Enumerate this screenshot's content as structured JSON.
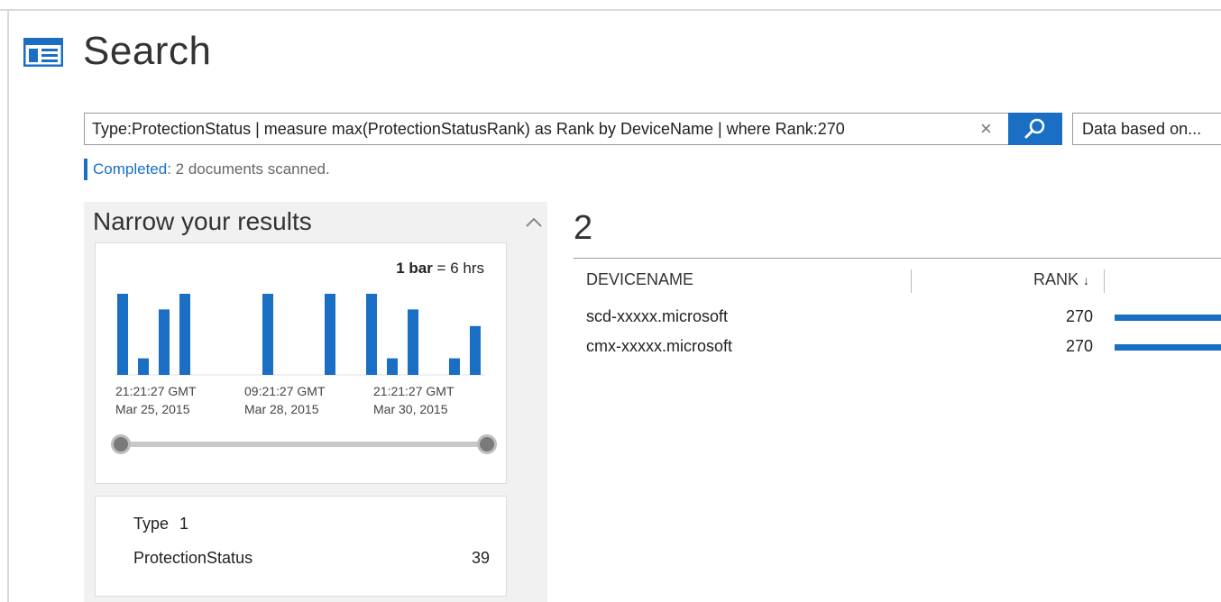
{
  "page": {
    "title": "Search"
  },
  "search": {
    "query": "Type:ProtectionStatus | measure max(ProtectionStatusRank) as Rank by DeviceName | where Rank:270",
    "clear_symbol": "×",
    "data_based_label": "Data based on..."
  },
  "status": {
    "completed": "Completed",
    "detail": " : 2 documents scanned."
  },
  "narrow": {
    "title": "Narrow your results",
    "legend_bold": "1 bar",
    "legend_rest": " = 6 hrs",
    "type_label": "Type",
    "type_count": "1",
    "type_value": "ProtectionStatus",
    "type_value_count": "39",
    "slider": {
      "start": 0,
      "end": 1
    }
  },
  "chart_data": {
    "type": "bar",
    "values": [
      88,
      18,
      71,
      88,
      0,
      0,
      0,
      88,
      0,
      0,
      88,
      0,
      88,
      18,
      71,
      0,
      18,
      53
    ],
    "tick_labels": [
      {
        "time": "21:21:27 GMT",
        "date": "Mar 25, 2015"
      },
      {
        "time": "09:21:27 GMT",
        "date": "Mar 28, 2015"
      },
      {
        "time": "21:21:27 GMT",
        "date": "Mar 30, 2015"
      }
    ],
    "color": "#1a6fc4"
  },
  "results": {
    "count": "2",
    "columns": {
      "device": "DEVICENAME",
      "rank": "RANK"
    },
    "sort_indicator": "↓",
    "rows": [
      {
        "device": "scd-xxxxx.microsoft",
        "rank": "270"
      },
      {
        "device": "cmx-xxxxx.microsoft",
        "rank": "270"
      }
    ]
  },
  "colors": {
    "accent": "#1a6fc4",
    "panel_bg": "#f1f1f1"
  }
}
